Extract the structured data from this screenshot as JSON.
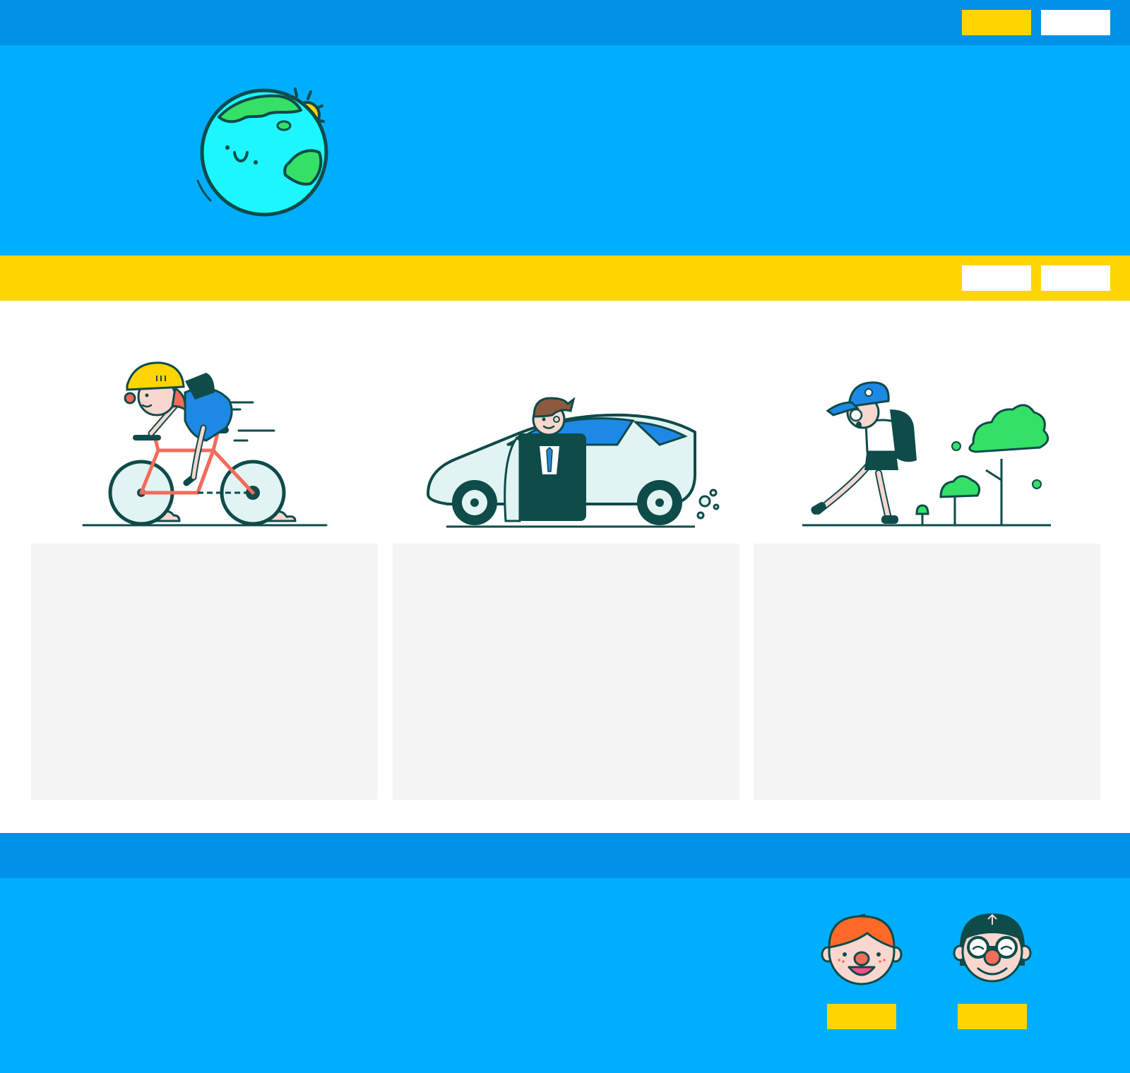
{
  "colors": {
    "top_nav": "#0091E8",
    "hero": "#00AEFF",
    "secondary_nav": "#FFD500",
    "card": "#F4F4F4",
    "footer_nav": "#0091E8",
    "footer": "#00AEFF",
    "button_yellow": "#FFD500",
    "button_white": "#FFFFFF",
    "outline": "#0E4B49"
  },
  "top_nav": {
    "buttons": [
      {
        "style": "yellow"
      },
      {
        "style": "white"
      }
    ]
  },
  "hero": {
    "illustration": "smiling-earth-with-sun-icon"
  },
  "secondary_nav": {
    "buttons": [
      {
        "style": "white"
      },
      {
        "style": "white"
      }
    ]
  },
  "features": [
    {
      "illustration": "cyclist-icon"
    },
    {
      "illustration": "businessman-with-car-icon"
    },
    {
      "illustration": "walking-schoolboy-icon"
    }
  ],
  "footer": {
    "profiles": [
      {
        "avatar": "redhead-boy-avatar-icon",
        "button_style": "yellow"
      },
      {
        "avatar": "glasses-person-avatar-icon",
        "button_style": "yellow"
      }
    ]
  }
}
